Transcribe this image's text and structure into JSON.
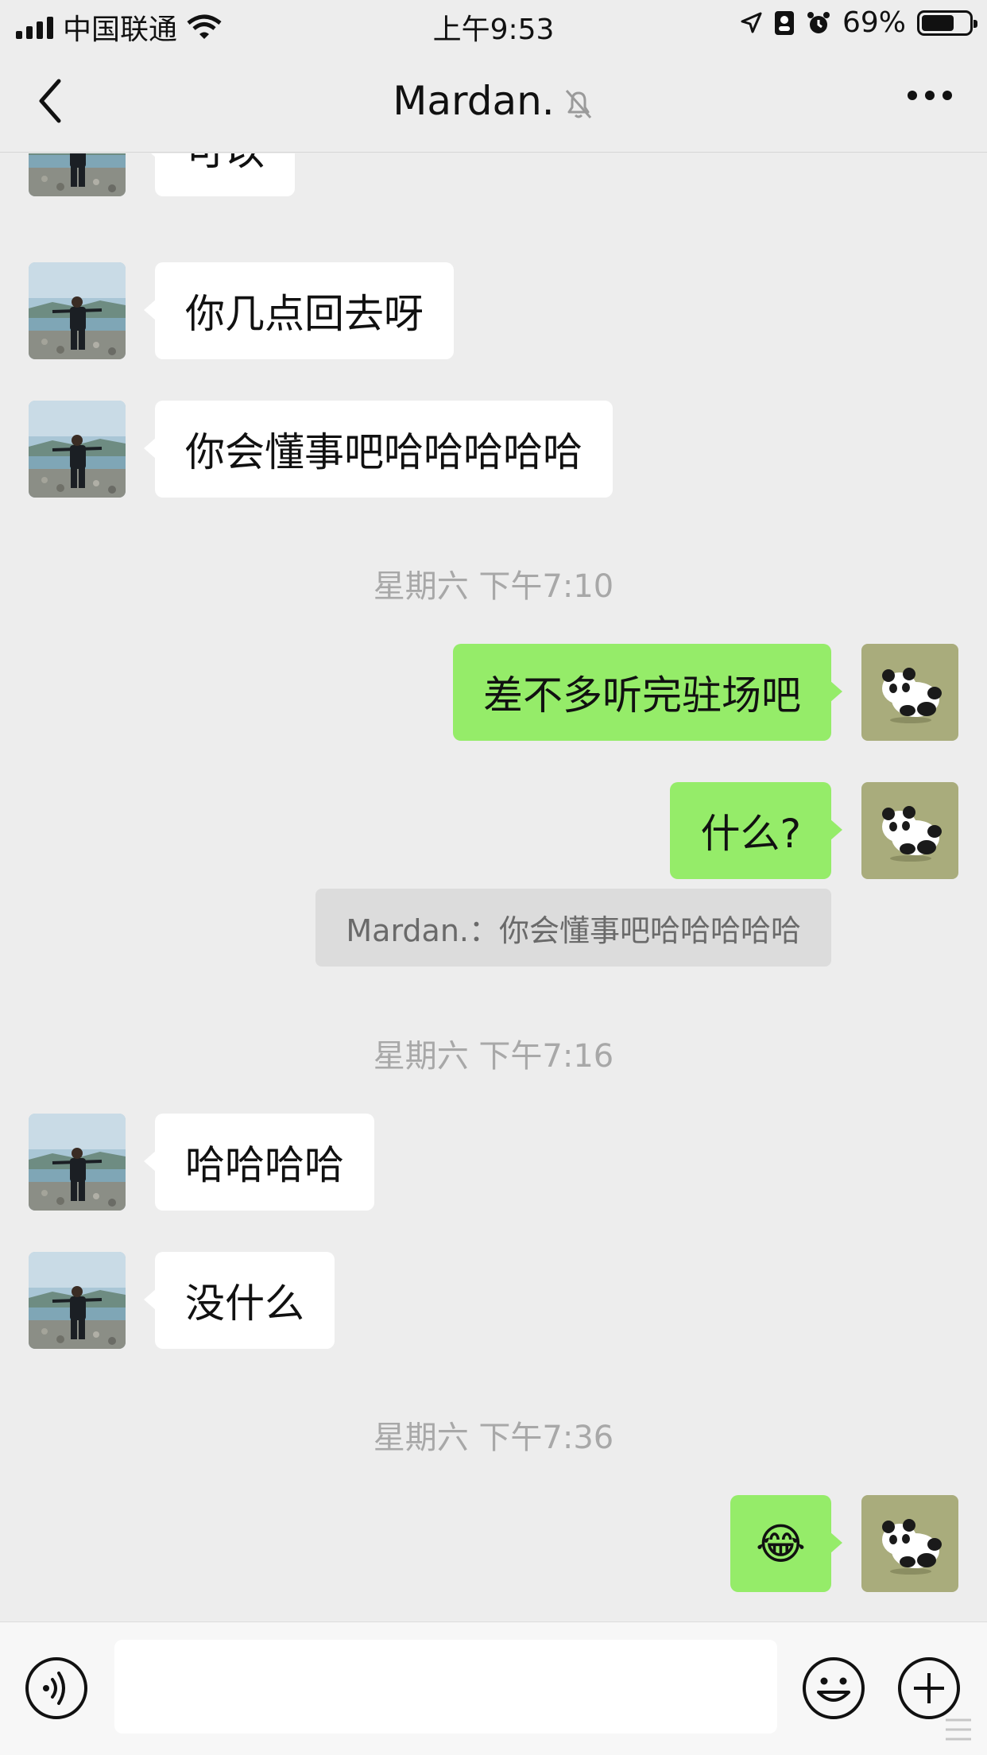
{
  "status_bar": {
    "carrier": "中国联通",
    "time": "上午9:53",
    "battery": "69%",
    "battery_level": 0.69
  },
  "nav": {
    "title": "Mardan.",
    "back_icon": "chevron-left-icon",
    "mute_icon": "bell-slash-icon",
    "more_icon": "more-icon"
  },
  "messages": [
    {
      "side": "left",
      "text": "可以"
    },
    {
      "side": "left",
      "text": "你几点回去呀"
    },
    {
      "side": "left",
      "text": "你会懂事吧哈哈哈哈哈"
    },
    {
      "type": "timestamp",
      "text": "星期六 下午7:10"
    },
    {
      "side": "right",
      "text": "差不多听完驻场吧"
    },
    {
      "side": "right",
      "text": "什么?"
    },
    {
      "type": "quote",
      "text": "Mardan.：你会懂事吧哈哈哈哈哈"
    },
    {
      "type": "timestamp",
      "text": "星期六 下午7:16"
    },
    {
      "side": "left",
      "text": "哈哈哈哈"
    },
    {
      "side": "left",
      "text": "没什么"
    },
    {
      "type": "timestamp",
      "text": "星期六 下午7:36"
    },
    {
      "side": "right",
      "text": "😂"
    }
  ],
  "input_bar": {
    "voice_icon": "voice-icon",
    "emoji_icon": "emoji-icon",
    "plus_icon": "plus-icon",
    "text_value": ""
  },
  "colors": {
    "background": "#ededed",
    "bubble_self": "#95ec69",
    "bubble_other": "#ffffff",
    "timestamp": "#a8a8a8"
  }
}
